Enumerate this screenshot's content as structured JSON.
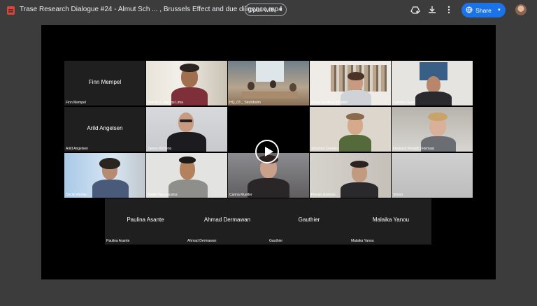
{
  "header": {
    "title": "Trase Research Dialogue #24 - Almut Sch ... , Brussels Effect and due diligence.mp4",
    "open_with": "Open with",
    "share": "Share"
  },
  "icons": {
    "file": "video-file-icon",
    "add_to_drive": "add-to-drive-icon",
    "download": "download-icon",
    "more": "more-vert-icon",
    "globe": "globe-icon",
    "avatar": "account-avatar"
  },
  "participants": {
    "finn": {
      "name": "Finn Mempel",
      "caption": "Finn Mempel"
    },
    "mairon": {
      "caption": "Mairon G. Bastos Lima"
    },
    "hq": {
      "caption": "HQ_03 _ Stockholm"
    },
    "almut": {
      "caption": "Almut Schilling-Vacaflor"
    },
    "valentin": {
      "caption": "Valentin Guye"
    },
    "arild": {
      "name": "Arild Angelsen",
      "caption": "Arild Angelsen"
    },
    "james": {
      "caption": "James Richens"
    },
    "johanna": {
      "caption": "Johanna Coenen"
    },
    "florence": {
      "caption": "Florence Pendrill (Formas)"
    },
    "cecile": {
      "caption": "Cécile Renier"
    },
    "andre": {
      "caption": "André Vasconcelos"
    },
    "carina": {
      "caption": "Carina Mueller"
    },
    "florian": {
      "caption": "Florian Gollnow"
    },
    "simon": {
      "caption": "Simon"
    },
    "paulina": {
      "name": "Paulina Asante",
      "caption": "Paulina Asante"
    },
    "ahmad": {
      "name": "Ahmad Dermawan",
      "caption": "Ahmad Dermawan"
    },
    "gauthier": {
      "name": "Gauthier",
      "caption": "Gauthier"
    },
    "malaika": {
      "name": "Malaika Yanou",
      "caption": "Malaika Yanou"
    }
  }
}
